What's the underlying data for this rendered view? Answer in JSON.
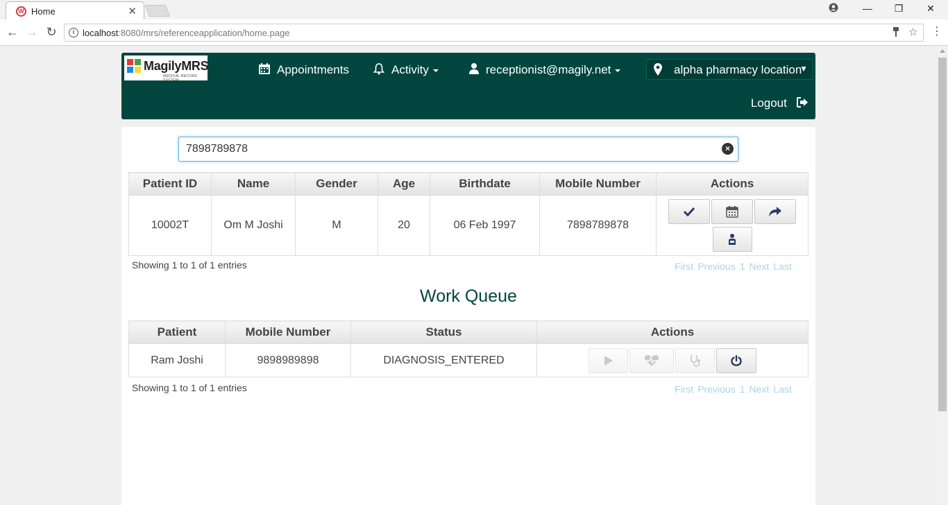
{
  "browser": {
    "tab_title": "Home",
    "favicon_letter": "W",
    "url_host": "localhost",
    "url_rest": ":8080/mrs/referenceapplication/home.page"
  },
  "header": {
    "logo_text": "MagilyMRS",
    "logo_sub": "MEDICAL RECORD SYSTEM",
    "appointments": "Appointments",
    "activity": "Activity",
    "user": "receptionist@magily.net",
    "location": "alpha pharmacy location",
    "logout": "Logout"
  },
  "search": {
    "value": "7898789878"
  },
  "patients": {
    "headers": [
      "Patient ID",
      "Name",
      "Gender",
      "Age",
      "Birthdate",
      "Mobile Number",
      "Actions"
    ],
    "rows": [
      {
        "id": "10002T",
        "name": "Om M Joshi",
        "gender": "M",
        "age": "20",
        "birthdate": "06 Feb 1997",
        "mobile": "7898789878"
      }
    ],
    "actions": [
      "check-icon",
      "calendar-icon",
      "share-icon",
      "patient-icon"
    ],
    "info": "Showing 1 to 1 of 1 entries",
    "pager": {
      "first": "First",
      "previous": "Previous",
      "page": "1",
      "next": "Next",
      "last": "Last"
    }
  },
  "work_queue": {
    "title": "Work Queue",
    "headers": [
      "Patient",
      "Mobile Number",
      "Status",
      "Actions"
    ],
    "rows": [
      {
        "patient": "Ram Joshi",
        "mobile": "9898989898",
        "status": "DIAGNOSIS_ENTERED"
      }
    ],
    "actions": [
      "play-icon",
      "heart-icon",
      "stethoscope-icon",
      "power-icon"
    ],
    "info": "Showing 1 to 1 of 1 entries",
    "pager": {
      "first": "First",
      "previous": "Previous",
      "page": "1",
      "next": "Next",
      "last": "Last"
    }
  },
  "colors": {
    "header_bg": "#00463f",
    "pager_link": "#a9d3ee",
    "search_focus": "#66afe9"
  }
}
